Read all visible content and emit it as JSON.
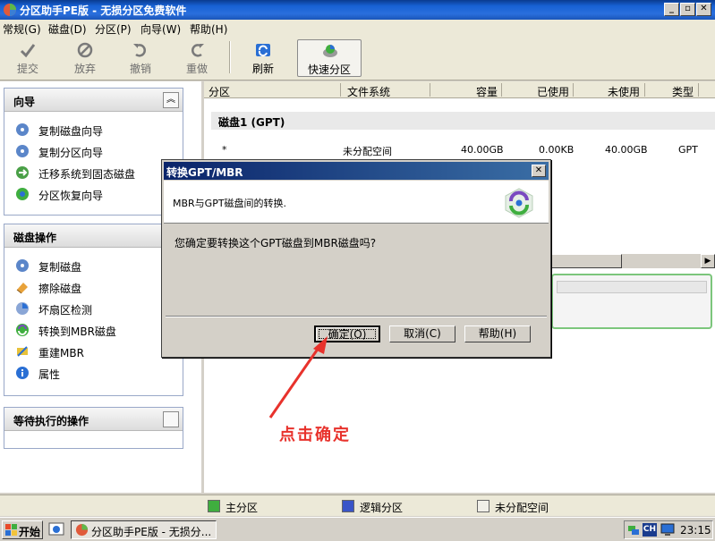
{
  "window": {
    "title": "分区助手PE版 - 无损分区免费软件"
  },
  "menu": [
    "常规(G)",
    "磁盘(D)",
    "分区(P)",
    "向导(W)",
    "帮助(H)"
  ],
  "toolbar": [
    {
      "label": "提交",
      "icon": "check-icon",
      "enabled": false
    },
    {
      "label": "放弃",
      "icon": "discard-icon",
      "enabled": false
    },
    {
      "label": "撤销",
      "icon": "undo-icon",
      "enabled": false
    },
    {
      "label": "重做",
      "icon": "redo-icon",
      "enabled": false
    },
    {
      "label": "刷新",
      "icon": "refresh-icon",
      "enabled": true
    },
    {
      "label": "快速分区",
      "icon": "quick-partition-icon",
      "enabled": true
    }
  ],
  "wizard": {
    "title": "向导",
    "items": [
      "复制磁盘向导",
      "复制分区向导",
      "迁移系统到固态磁盘",
      "分区恢复向导"
    ]
  },
  "disk_ops": {
    "title": "磁盘操作",
    "items": [
      "复制磁盘",
      "擦除磁盘",
      "坏扇区检测",
      "转换到MBR磁盘",
      "重建MBR",
      "属性"
    ]
  },
  "pending": {
    "title": "等待执行的操作"
  },
  "table": {
    "columns": [
      "分区",
      "文件系统",
      "容量",
      "已使用",
      "未使用",
      "类型"
    ],
    "disk_label": "磁盘1 (GPT)",
    "row": [
      "*",
      "未分配空间",
      "40.00GB",
      "0.00KB",
      "40.00GB",
      "GPT"
    ]
  },
  "legend": [
    "主分区",
    "逻辑分区",
    "未分配空间"
  ],
  "dialog": {
    "title": "转换GPT/MBR",
    "header": "MBR与GPT磁盘间的转换.",
    "message": "您确定要转换这个GPT磁盘到MBR磁盘吗?",
    "ok": "确定(O)",
    "cancel": "取消(C)",
    "help": "帮助(H)"
  },
  "annotation": "点击确定",
  "taskbar": {
    "start": "开始",
    "task": "分区助手PE版 - 无损分...",
    "clock": "23:15",
    "ime": "CH"
  },
  "colors": {
    "primary": "#3fae3f",
    "logical": "#3a55c8",
    "unallocated": "#f0efe8",
    "annotation": "#e8322c"
  }
}
